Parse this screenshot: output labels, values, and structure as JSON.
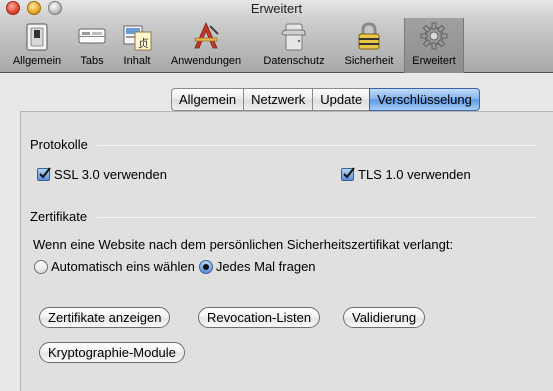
{
  "window": {
    "title": "Erweitert"
  },
  "toolbar": {
    "items": [
      {
        "label": "Allgemein",
        "icon": "switch-icon"
      },
      {
        "label": "Tabs",
        "icon": "tabs-icon"
      },
      {
        "label": "Inhalt",
        "icon": "content-icon"
      },
      {
        "label": "Anwendungen",
        "icon": "applications-icon"
      },
      {
        "label": "Datenschutz",
        "icon": "mask-icon"
      },
      {
        "label": "Sicherheit",
        "icon": "lock-icon"
      },
      {
        "label": "Erweitert",
        "icon": "gear-icon",
        "selected": true
      }
    ]
  },
  "tabs": [
    {
      "label": "Allgemein"
    },
    {
      "label": "Netzwerk"
    },
    {
      "label": "Update"
    },
    {
      "label": "Verschlüsselung",
      "active": true
    }
  ],
  "protocols": {
    "title": "Protokolle",
    "ssl": {
      "label": "SSL 3.0 verwenden",
      "checked": true
    },
    "tls": {
      "label": "TLS 1.0 verwenden",
      "checked": true
    }
  },
  "certificates": {
    "title": "Zertifikate",
    "prompt": "Wenn eine Website nach dem persönlichen Sicherheitszertifikat verlangt:",
    "options": [
      {
        "label": "Automatisch eins wählen",
        "selected": false
      },
      {
        "label": "Jedes Mal fragen",
        "selected": true
      }
    ],
    "buttons": {
      "show": "Zertifikate anzeigen",
      "revocation": "Revocation-Listen",
      "validation": "Validierung",
      "crypto": "Kryptographie-Module"
    }
  },
  "colors": {
    "accent": "#5b97e3",
    "toolbar": "#a8a8a8",
    "background": "#e8e8e8"
  }
}
